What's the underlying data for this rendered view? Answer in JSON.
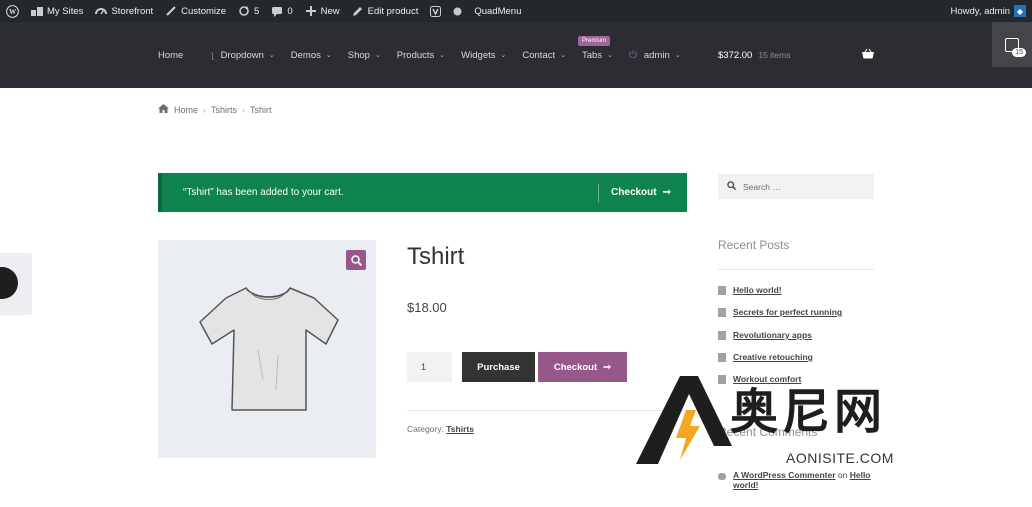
{
  "adminbar": {
    "my_sites": "My Sites",
    "storefront": "Storefront",
    "customize": "Customize",
    "updates": "5",
    "comments": "0",
    "new": "New",
    "edit_product": "Edit product",
    "quadmenu": "QuadMenu",
    "howdy": "Howdy, admin"
  },
  "nav": {
    "items": [
      {
        "label": "Home"
      },
      {
        "label": "Dropdown"
      },
      {
        "label": "Demos"
      },
      {
        "label": "Shop"
      },
      {
        "label": "Products"
      },
      {
        "label": "Widgets"
      },
      {
        "label": "Contact"
      },
      {
        "label": "Tabs"
      },
      {
        "label": "admin"
      }
    ],
    "premium_badge": "Premium",
    "cart_total": "$372.00",
    "cart_count": "15 items",
    "side_cart_count": "15"
  },
  "breadcrumb": {
    "home": "Home",
    "category": "Tshirts",
    "current": "Tshirt"
  },
  "notice": {
    "message": "“Tshirt” has been added to your cart.",
    "checkout": "Checkout"
  },
  "product": {
    "title": "Tshirt",
    "price": "$18.00",
    "quantity": "1",
    "purchase": "Purchase",
    "checkout": "Checkout",
    "category_label": "Category:",
    "category": "Tshirts"
  },
  "sidebar": {
    "search_placeholder": "Search …",
    "recent_posts_title": "Recent Posts",
    "posts": [
      "Hello world!",
      "Secrets for perfect running",
      "Revolutionary apps",
      "Creative retouching",
      "Workout comfort"
    ],
    "recent_comments_title": "Recent Comments",
    "comment_author": "A WordPress Commenter",
    "comment_on": "on",
    "comment_post": "Hello world!"
  },
  "watermark": {
    "text": "奥尼网",
    "sub": "AONISITE.COM"
  },
  "colors": {
    "adminbar": "#23282d",
    "header": "#2c2d33",
    "notice": "#0f834d",
    "accent": "#96588a",
    "dark_button": "#333333"
  }
}
